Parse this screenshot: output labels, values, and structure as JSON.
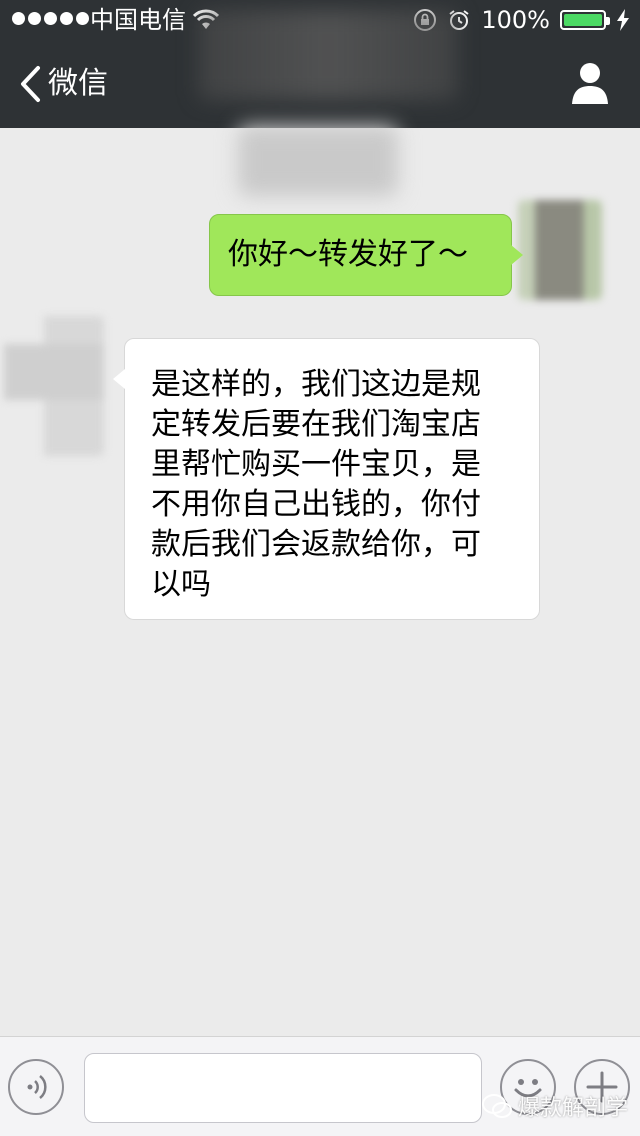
{
  "status_bar": {
    "carrier": "中国电信",
    "battery_percent": "100%"
  },
  "nav": {
    "back_label": "微信"
  },
  "messages": [
    {
      "direction": "sent",
      "text": "你好～转发好了～"
    },
    {
      "direction": "received",
      "lines": [
        "是这样的，我们这边是规",
        "定转发后要在我们淘宝店",
        "里帮忙购买一件宝贝，是",
        "不用你自己出钱的，你付",
        "款后我们会返款给你，可",
        "以吗"
      ]
    }
  ],
  "input": {
    "value": "",
    "placeholder": ""
  },
  "watermark": {
    "text": "爆款解剖学"
  },
  "icons": {
    "back": "chevron-left-icon",
    "profile": "person-icon",
    "voice": "voice-icon",
    "emoji": "smiley-icon",
    "more": "plus-icon"
  },
  "colors": {
    "navbar": "#2e3235",
    "chat_background": "#ebebeb",
    "sent_bubble": "#a0e75a",
    "received_bubble": "#ffffff",
    "battery": "#4cd964"
  }
}
